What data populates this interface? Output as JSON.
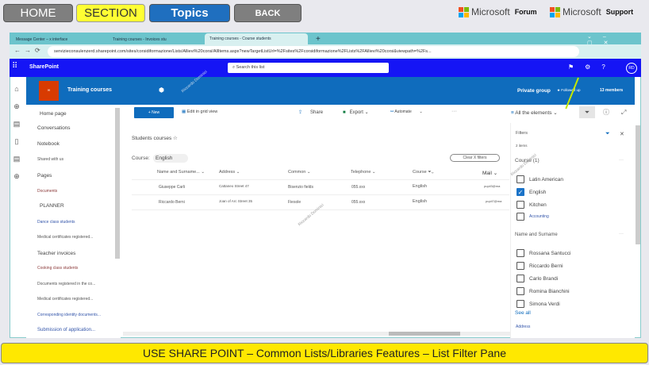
{
  "topnav": {
    "home": "HOME",
    "section": "SECTION",
    "topics": "Topics",
    "back": "BACK"
  },
  "brand": {
    "forum_name": "Microsoft",
    "forum_label": "Forum",
    "support_name": "Microsoft",
    "support_label": "Support"
  },
  "browser": {
    "tabs": [
      "Message Center – x interface",
      "Training courses - Invoices stu",
      "Training courses - Course students"
    ],
    "new_tab": "+",
    "url": "servizieconsulenzerd.sharepoint.com/sites/corsidiformazione/Lists/Allievi%20corsi/AllItems.aspx?newTargetListUrl=%2Fsites%2Fcorsidiformazione%2FLists%2FAllievi%20corsi&viewpath=%2Fs..."
  },
  "sharepoint": {
    "app": "SharePoint",
    "search_placeholder": "Search this list",
    "avatar": "RD"
  },
  "site": {
    "title": "Training courses",
    "privacy": "Private group",
    "follow": "Followed up",
    "members": "13 members"
  },
  "nav": [
    "Home page",
    "Conversations",
    "Notebook",
    "Shared with us",
    "Pages",
    "Documents",
    "PLANNER",
    "Dance class students",
    "Medical certificates registered...",
    "Teacher invoices",
    "Cooking class students",
    "Documents registered in the co...",
    "Medical certificates registered...",
    "Corresponding identity documents...",
    "Submission of application..."
  ],
  "toolbar": {
    "new": "+ New",
    "grid": "Edit in grid view",
    "share": "Share",
    "export": "Export",
    "automate": "Automate",
    "more": "···",
    "view": "All the elements"
  },
  "list": {
    "title": "Students courses ☆",
    "filter_label": "Course:",
    "filter_value": "English",
    "clear": "Clear X filters",
    "columns": [
      "Name and Surname...",
      "Address",
      "Common",
      "Telephone",
      "Course",
      "Mail"
    ],
    "rows": [
      [
        "Giuseppe Carli",
        "Cattaneo Street 47",
        "Bisenzio fields",
        "055.xxx",
        "English",
        "pupil3@ma"
      ],
      [
        "Riccardo Berni",
        "Joan of Arc Street 35",
        "Fiesole",
        "055.xxx",
        "English",
        "pupil7@ma"
      ]
    ]
  },
  "filters": {
    "title": "Filters",
    "count": "2 items",
    "course_head": "Course (1)",
    "course_opts": [
      {
        "label": "Latin American",
        "checked": false
      },
      {
        "label": "English",
        "checked": true
      },
      {
        "label": "Kitchen",
        "checked": false
      },
      {
        "label": "Accounting",
        "checked": false
      }
    ],
    "name_head": "Name and Surname",
    "names": [
      "Rossana Santucci",
      "Riccardo Berni",
      "Carlo Brandi",
      "Romina Bianchini",
      "Simona Verdi"
    ],
    "see_all": "See all",
    "address_head": "Address",
    "more": "···"
  },
  "watermark": "Riccardo Dominici",
  "banner": "USE SHARE POINT – Common Lists/Libraries Features – List Filter Pane",
  "colors": {
    "sp_bar": "#1515f5",
    "site_header": "#0f6cbd",
    "accent": "#0f6cbd",
    "banner": "#ffe800"
  }
}
